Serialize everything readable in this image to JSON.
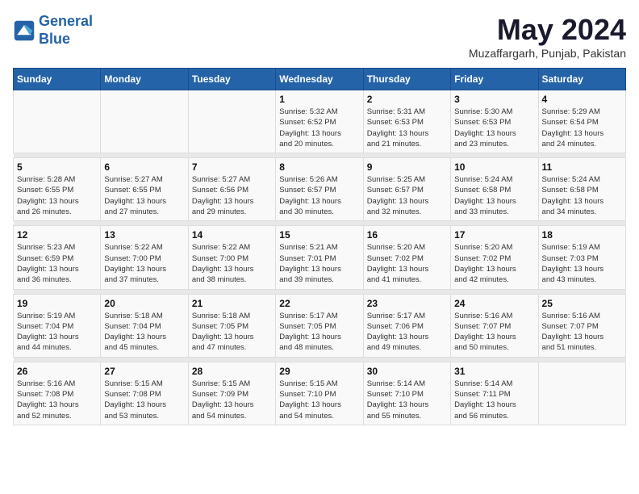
{
  "logo": {
    "line1": "General",
    "line2": "Blue"
  },
  "title": "May 2024",
  "location": "Muzaffargarh, Punjab, Pakistan",
  "weekdays": [
    "Sunday",
    "Monday",
    "Tuesday",
    "Wednesday",
    "Thursday",
    "Friday",
    "Saturday"
  ],
  "weeks": [
    [
      {
        "day": "",
        "info": ""
      },
      {
        "day": "",
        "info": ""
      },
      {
        "day": "",
        "info": ""
      },
      {
        "day": "1",
        "info": "Sunrise: 5:32 AM\nSunset: 6:52 PM\nDaylight: 13 hours\nand 20 minutes."
      },
      {
        "day": "2",
        "info": "Sunrise: 5:31 AM\nSunset: 6:53 PM\nDaylight: 13 hours\nand 21 minutes."
      },
      {
        "day": "3",
        "info": "Sunrise: 5:30 AM\nSunset: 6:53 PM\nDaylight: 13 hours\nand 23 minutes."
      },
      {
        "day": "4",
        "info": "Sunrise: 5:29 AM\nSunset: 6:54 PM\nDaylight: 13 hours\nand 24 minutes."
      }
    ],
    [
      {
        "day": "5",
        "info": "Sunrise: 5:28 AM\nSunset: 6:55 PM\nDaylight: 13 hours\nand 26 minutes."
      },
      {
        "day": "6",
        "info": "Sunrise: 5:27 AM\nSunset: 6:55 PM\nDaylight: 13 hours\nand 27 minutes."
      },
      {
        "day": "7",
        "info": "Sunrise: 5:27 AM\nSunset: 6:56 PM\nDaylight: 13 hours\nand 29 minutes."
      },
      {
        "day": "8",
        "info": "Sunrise: 5:26 AM\nSunset: 6:57 PM\nDaylight: 13 hours\nand 30 minutes."
      },
      {
        "day": "9",
        "info": "Sunrise: 5:25 AM\nSunset: 6:57 PM\nDaylight: 13 hours\nand 32 minutes."
      },
      {
        "day": "10",
        "info": "Sunrise: 5:24 AM\nSunset: 6:58 PM\nDaylight: 13 hours\nand 33 minutes."
      },
      {
        "day": "11",
        "info": "Sunrise: 5:24 AM\nSunset: 6:58 PM\nDaylight: 13 hours\nand 34 minutes."
      }
    ],
    [
      {
        "day": "12",
        "info": "Sunrise: 5:23 AM\nSunset: 6:59 PM\nDaylight: 13 hours\nand 36 minutes."
      },
      {
        "day": "13",
        "info": "Sunrise: 5:22 AM\nSunset: 7:00 PM\nDaylight: 13 hours\nand 37 minutes."
      },
      {
        "day": "14",
        "info": "Sunrise: 5:22 AM\nSunset: 7:00 PM\nDaylight: 13 hours\nand 38 minutes."
      },
      {
        "day": "15",
        "info": "Sunrise: 5:21 AM\nSunset: 7:01 PM\nDaylight: 13 hours\nand 39 minutes."
      },
      {
        "day": "16",
        "info": "Sunrise: 5:20 AM\nSunset: 7:02 PM\nDaylight: 13 hours\nand 41 minutes."
      },
      {
        "day": "17",
        "info": "Sunrise: 5:20 AM\nSunset: 7:02 PM\nDaylight: 13 hours\nand 42 minutes."
      },
      {
        "day": "18",
        "info": "Sunrise: 5:19 AM\nSunset: 7:03 PM\nDaylight: 13 hours\nand 43 minutes."
      }
    ],
    [
      {
        "day": "19",
        "info": "Sunrise: 5:19 AM\nSunset: 7:04 PM\nDaylight: 13 hours\nand 44 minutes."
      },
      {
        "day": "20",
        "info": "Sunrise: 5:18 AM\nSunset: 7:04 PM\nDaylight: 13 hours\nand 45 minutes."
      },
      {
        "day": "21",
        "info": "Sunrise: 5:18 AM\nSunset: 7:05 PM\nDaylight: 13 hours\nand 47 minutes."
      },
      {
        "day": "22",
        "info": "Sunrise: 5:17 AM\nSunset: 7:05 PM\nDaylight: 13 hours\nand 48 minutes."
      },
      {
        "day": "23",
        "info": "Sunrise: 5:17 AM\nSunset: 7:06 PM\nDaylight: 13 hours\nand 49 minutes."
      },
      {
        "day": "24",
        "info": "Sunrise: 5:16 AM\nSunset: 7:07 PM\nDaylight: 13 hours\nand 50 minutes."
      },
      {
        "day": "25",
        "info": "Sunrise: 5:16 AM\nSunset: 7:07 PM\nDaylight: 13 hours\nand 51 minutes."
      }
    ],
    [
      {
        "day": "26",
        "info": "Sunrise: 5:16 AM\nSunset: 7:08 PM\nDaylight: 13 hours\nand 52 minutes."
      },
      {
        "day": "27",
        "info": "Sunrise: 5:15 AM\nSunset: 7:08 PM\nDaylight: 13 hours\nand 53 minutes."
      },
      {
        "day": "28",
        "info": "Sunrise: 5:15 AM\nSunset: 7:09 PM\nDaylight: 13 hours\nand 54 minutes."
      },
      {
        "day": "29",
        "info": "Sunrise: 5:15 AM\nSunset: 7:10 PM\nDaylight: 13 hours\nand 54 minutes."
      },
      {
        "day": "30",
        "info": "Sunrise: 5:14 AM\nSunset: 7:10 PM\nDaylight: 13 hours\nand 55 minutes."
      },
      {
        "day": "31",
        "info": "Sunrise: 5:14 AM\nSunset: 7:11 PM\nDaylight: 13 hours\nand 56 minutes."
      },
      {
        "day": "",
        "info": ""
      }
    ]
  ]
}
